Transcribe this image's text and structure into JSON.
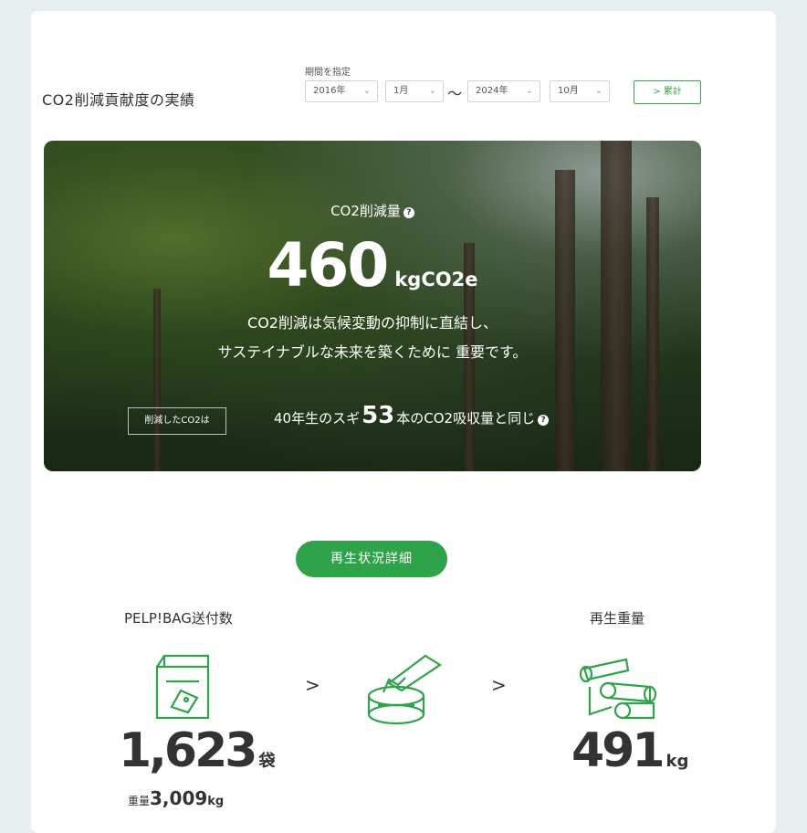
{
  "title": "CO2削減貢献度の実績",
  "period": {
    "label": "期間を指定",
    "start_year": "2016年",
    "start_month": "1月",
    "separator": "〜",
    "end_year": "2024年",
    "end_month": "10月",
    "total_button": "> 累計"
  },
  "hero": {
    "label": "CO2削減量",
    "value": "460",
    "unit": "kgCO2e",
    "text_line1": "CO2削減は気候変動の抑制に直結し、",
    "text_line2": "サステイナブルな未来を築くために 重要です。",
    "tag": "削減したCO2は",
    "tree_prefix": "40年生のスギ",
    "tree_count": "53",
    "tree_suffix": "本のCO2吸収量と同じ"
  },
  "detail_button": "再生状況詳細",
  "stats": {
    "bags_label": "PELP!BAG送付数",
    "bags_value": "1,623",
    "bags_unit": "袋",
    "weight_label": "重量",
    "weight_value": "3,009",
    "weight_unit": "kg",
    "regen_label": "再生重量",
    "regen_value": "491",
    "regen_unit": "kg",
    "arrow": ">"
  },
  "icons": [
    "bag-icon",
    "recycle-machine-icon",
    "paper-rolls-icon",
    "question-icon",
    "chevron-down-icon"
  ],
  "colors": {
    "accent": "#2ea34a",
    "background": "#e7eeef"
  }
}
